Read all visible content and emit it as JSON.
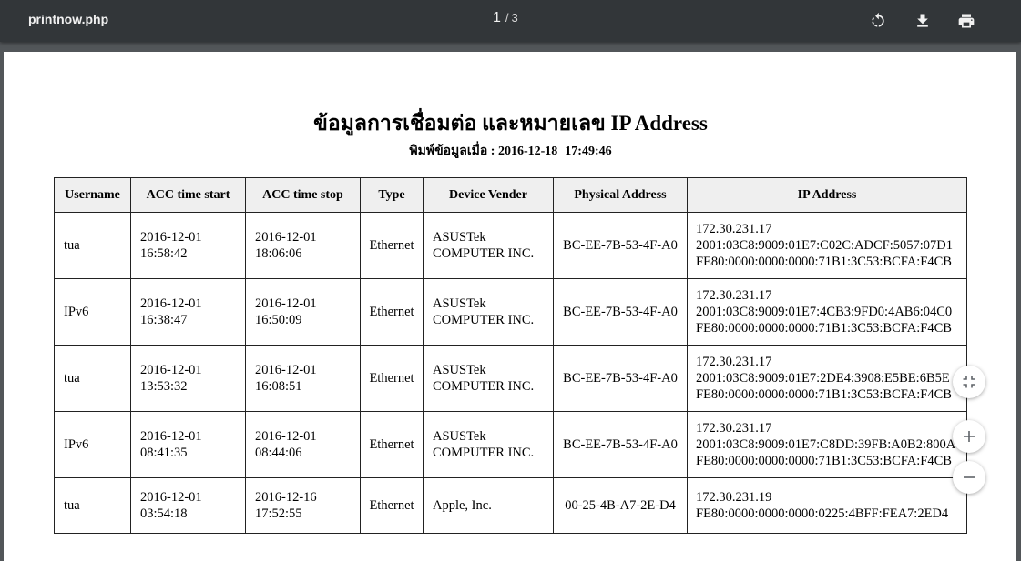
{
  "toolbar": {
    "title": "printnow.php",
    "page_current": "1",
    "page_separator": "/",
    "page_total": "3",
    "rotate_icon": "rotate-icon",
    "download_icon": "download-icon",
    "print_icon": "print-icon"
  },
  "report": {
    "title": "ข้อมูลการเชื่อมต่อ และหมายเลข IP Address",
    "printed_label": "พิมพ์ข้อมูลเมื่อ :",
    "printed_date": "2016-12-18",
    "printed_time": "17:49:46"
  },
  "table": {
    "headers": [
      "Username",
      "ACC time start",
      "ACC time stop",
      "Type",
      "Device Vender",
      "Physical Address",
      "IP Address"
    ],
    "rows": [
      {
        "username": "tua",
        "start_date": "2016-12-01",
        "start_time": "16:58:42",
        "stop_date": "2016-12-01",
        "stop_time": "18:06:06",
        "type": "Ethernet",
        "vendor": [
          "ASUSTek",
          "COMPUTER INC."
        ],
        "mac": "BC-EE-7B-53-4F-A0",
        "ips": [
          "172.30.231.17",
          "2001:03C8:9009:01E7:C02C:ADCF:5057:07D1",
          "FE80:0000:0000:0000:71B1:3C53:BCFA:F4CB"
        ]
      },
      {
        "username": "IPv6",
        "start_date": "2016-12-01",
        "start_time": "16:38:47",
        "stop_date": "2016-12-01",
        "stop_time": "16:50:09",
        "type": "Ethernet",
        "vendor": [
          "ASUSTek",
          "COMPUTER INC."
        ],
        "mac": "BC-EE-7B-53-4F-A0",
        "ips": [
          "172.30.231.17",
          "2001:03C8:9009:01E7:4CB3:9FD0:4AB6:04C0",
          "FE80:0000:0000:0000:71B1:3C53:BCFA:F4CB"
        ]
      },
      {
        "username": "tua",
        "start_date": "2016-12-01",
        "start_time": "13:53:32",
        "stop_date": "2016-12-01",
        "stop_time": "16:08:51",
        "type": "Ethernet",
        "vendor": [
          "ASUSTek",
          "COMPUTER INC."
        ],
        "mac": "BC-EE-7B-53-4F-A0",
        "ips": [
          "172.30.231.17",
          "2001:03C8:9009:01E7:2DE4:3908:E5BE:6B5E",
          "FE80:0000:0000:0000:71B1:3C53:BCFA:F4CB"
        ]
      },
      {
        "username": "IPv6",
        "start_date": "2016-12-01",
        "start_time": "08:41:35",
        "stop_date": "2016-12-01",
        "stop_time": "08:44:06",
        "type": "Ethernet",
        "vendor": [
          "ASUSTek",
          "COMPUTER INC."
        ],
        "mac": "BC-EE-7B-53-4F-A0",
        "ips": [
          "172.30.231.17",
          "2001:03C8:9009:01E7:C8DD:39FB:A0B2:800A",
          "FE80:0000:0000:0000:71B1:3C53:BCFA:F4CB"
        ]
      },
      {
        "username": "tua",
        "start_date": "2016-12-01",
        "start_time": "03:54:18",
        "stop_date": "2016-12-16",
        "stop_time": "17:52:55",
        "type": "Ethernet",
        "vendor": [
          "Apple, Inc."
        ],
        "mac": "00-25-4B-A7-2E-D4",
        "ips": [
          "172.30.231.19",
          "FE80:0000:0000:0000:0225:4BFF:FEA7:2ED4"
        ]
      }
    ]
  },
  "zoom_controls": {
    "fit_icon": "fit-to-page-icon",
    "zoom_in_icon": "zoom-in-icon",
    "zoom_out_icon": "zoom-out-icon"
  }
}
